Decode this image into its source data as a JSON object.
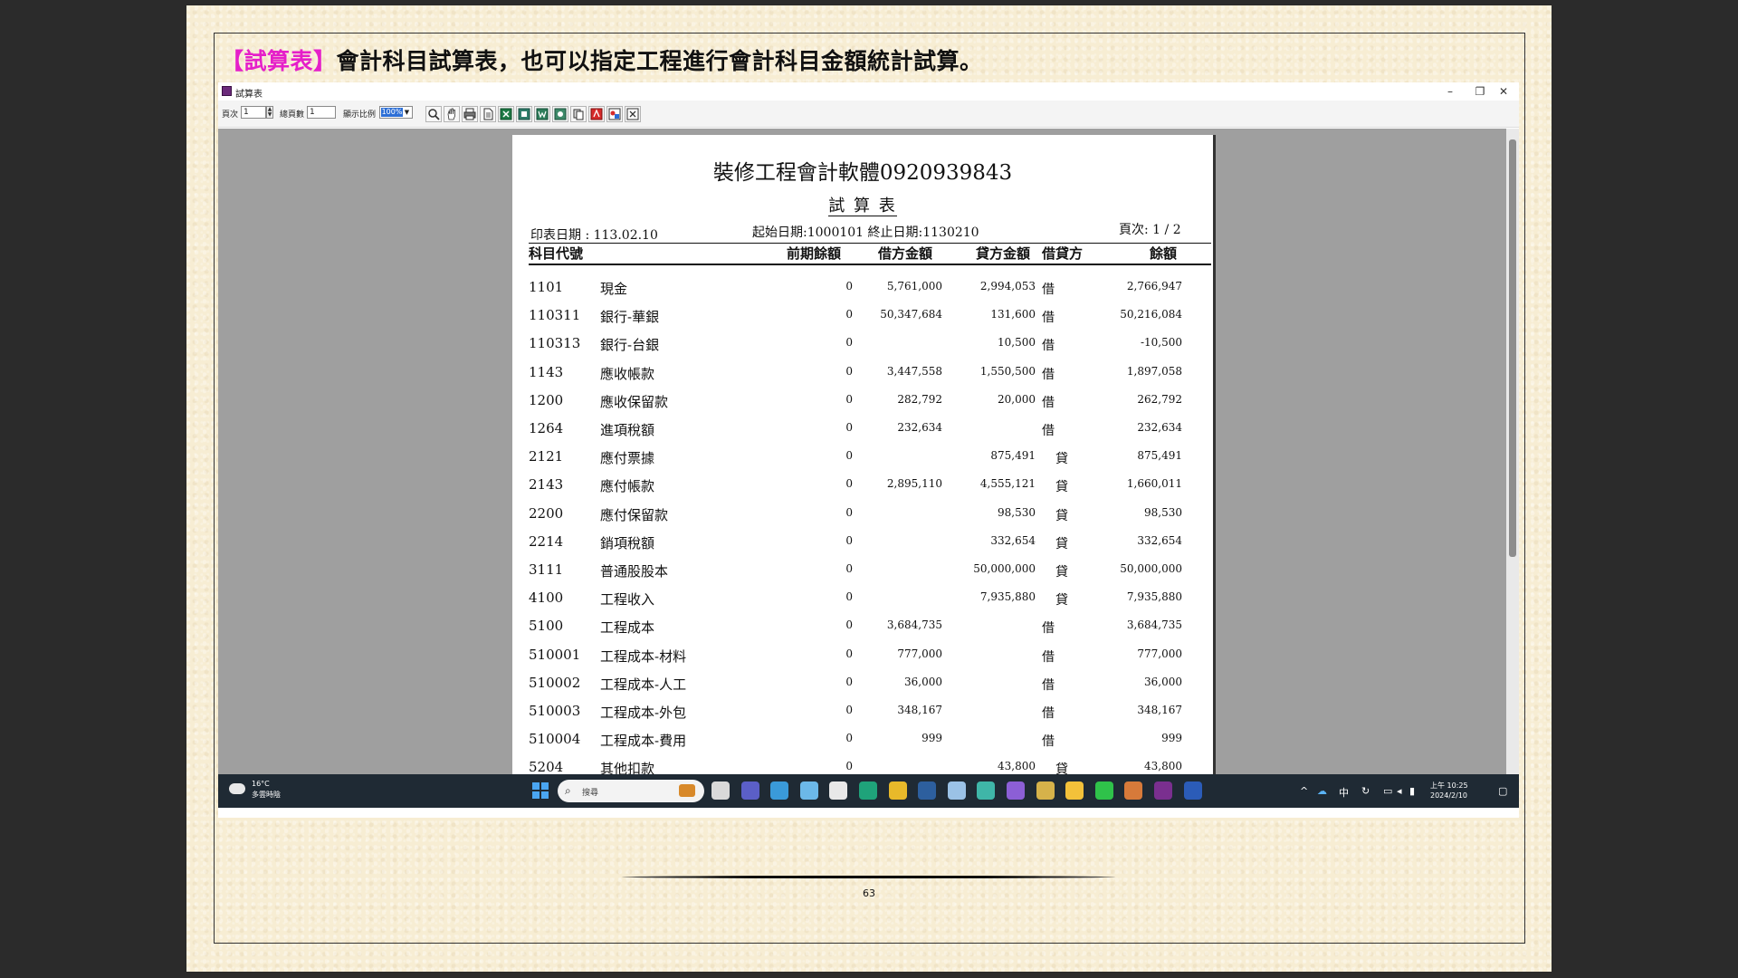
{
  "slide": {
    "heading_tag": "【試算表】",
    "heading_text": "會計科目試算表，也可以指定工程進行會計科目金額統計試算。",
    "page_number": "63"
  },
  "window": {
    "title": "試算表",
    "minimize": "–",
    "restore": "❐",
    "close": "✕"
  },
  "toolbar": {
    "page_label": "頁次",
    "page_value": "1",
    "total_label": "總頁數",
    "total_value": "1",
    "zoom_label": "顯示比例",
    "zoom_value": "100%",
    "buttons": [
      "zoom-icon",
      "hand-icon",
      "print-icon",
      "page-icon",
      "export-excel-icon",
      "export-icon",
      "export-word-icon",
      "export-rtf-icon",
      "copy-icon",
      "pdf-icon",
      "html-icon",
      "close-icon"
    ]
  },
  "report": {
    "company": "裝修工程會計軟體0920939843",
    "title": "試 算 表",
    "print_date": "印表日期 : 113.02.10",
    "range": "起始日期:1000101 終止日期:1130210",
    "page": "頁次: 1 / 2",
    "headers": {
      "code": "科目代號",
      "prev": "前期餘額",
      "debit": "借方金額",
      "credit": "貸方金額",
      "dir": "借貸方",
      "balance": "餘額"
    },
    "rows": [
      {
        "code": "1101",
        "name": "現金",
        "prev": "0",
        "debit": "5,761,000",
        "credit": "2,994,053",
        "dir": "借",
        "balance": "2,766,947"
      },
      {
        "code": "110311",
        "name": "銀行-華銀",
        "prev": "0",
        "debit": "50,347,684",
        "credit": "131,600",
        "dir": "借",
        "balance": "50,216,084"
      },
      {
        "code": "110313",
        "name": "銀行-台銀",
        "prev": "0",
        "debit": "",
        "credit": "10,500",
        "dir": "借",
        "balance": "-10,500"
      },
      {
        "code": "1143",
        "name": "應收帳款",
        "prev": "0",
        "debit": "3,447,558",
        "credit": "1,550,500",
        "dir": "借",
        "balance": "1,897,058"
      },
      {
        "code": "1200",
        "name": "應收保留款",
        "prev": "0",
        "debit": "282,792",
        "credit": "20,000",
        "dir": "借",
        "balance": "262,792"
      },
      {
        "code": "1264",
        "name": "進項稅額",
        "prev": "0",
        "debit": "232,634",
        "credit": "",
        "dir": "借",
        "balance": "232,634"
      },
      {
        "code": "2121",
        "name": "應付票據",
        "prev": "0",
        "debit": "",
        "credit": "875,491",
        "dir": "貸",
        "balance": "875,491"
      },
      {
        "code": "2143",
        "name": "應付帳款",
        "prev": "0",
        "debit": "2,895,110",
        "credit": "4,555,121",
        "dir": "貸",
        "balance": "1,660,011"
      },
      {
        "code": "2200",
        "name": "應付保留款",
        "prev": "0",
        "debit": "",
        "credit": "98,530",
        "dir": "貸",
        "balance": "98,530"
      },
      {
        "code": "2214",
        "name": "銷項稅額",
        "prev": "0",
        "debit": "",
        "credit": "332,654",
        "dir": "貸",
        "balance": "332,654"
      },
      {
        "code": "3111",
        "name": "普通股股本",
        "prev": "0",
        "debit": "",
        "credit": "50,000,000",
        "dir": "貸",
        "balance": "50,000,000"
      },
      {
        "code": "4100",
        "name": "工程收入",
        "prev": "0",
        "debit": "",
        "credit": "7,935,880",
        "dir": "貸",
        "balance": "7,935,880"
      },
      {
        "code": "5100",
        "name": "工程成本",
        "prev": "0",
        "debit": "3,684,735",
        "credit": "",
        "dir": "借",
        "balance": "3,684,735"
      },
      {
        "code": "510001",
        "name": "工程成本-材料",
        "prev": "0",
        "debit": "777,000",
        "credit": "",
        "dir": "借",
        "balance": "777,000"
      },
      {
        "code": "510002",
        "name": "工程成本-人工",
        "prev": "0",
        "debit": "36,000",
        "credit": "",
        "dir": "借",
        "balance": "36,000"
      },
      {
        "code": "510003",
        "name": "工程成本-外包",
        "prev": "0",
        "debit": "348,167",
        "credit": "",
        "dir": "借",
        "balance": "348,167"
      },
      {
        "code": "510004",
        "name": "工程成本-費用",
        "prev": "0",
        "debit": "999",
        "credit": "",
        "dir": "借",
        "balance": "999"
      },
      {
        "code": "5204",
        "name": "其他扣款",
        "prev": "0",
        "debit": "",
        "credit": "43,800",
        "dir": "貸",
        "balance": "43,800"
      }
    ]
  },
  "taskbar": {
    "weather_temp": "16°C",
    "weather_desc": "多雲時陰",
    "search_placeholder": "搜尋",
    "tray_lang": "中",
    "time": "上午 10:25",
    "date": "2024/2/10",
    "apps": [
      {
        "name": "task-view-icon",
        "color": "#d9d9d9"
      },
      {
        "name": "teams-icon",
        "color": "#5b5fc7"
      },
      {
        "name": "notepad-icon",
        "color": "#3a9ad9"
      },
      {
        "name": "photos-icon",
        "color": "#6cb8e8"
      },
      {
        "name": "store-icon",
        "color": "#e8e8e8"
      },
      {
        "name": "edge-icon",
        "color": "#1fa37a"
      },
      {
        "name": "chrome-icon",
        "color": "#e8b92a"
      },
      {
        "name": "app-icon-1",
        "color": "#2d5f9e"
      },
      {
        "name": "image-viewer-icon",
        "color": "#9bc2e6"
      },
      {
        "name": "edge-dev-icon",
        "color": "#3fb6a8"
      },
      {
        "name": "visual-studio-icon",
        "color": "#8c5fd6"
      },
      {
        "name": "tools-icon",
        "color": "#d6b24a"
      },
      {
        "name": "file-explorer-icon",
        "color": "#f3c13a"
      },
      {
        "name": "line-icon",
        "color": "#2fc24a"
      },
      {
        "name": "paint-icon",
        "color": "#d77a3a"
      },
      {
        "name": "accounting-app-icon",
        "color": "#7a2f8f"
      },
      {
        "name": "word-icon",
        "color": "#2b5cb8"
      }
    ]
  }
}
